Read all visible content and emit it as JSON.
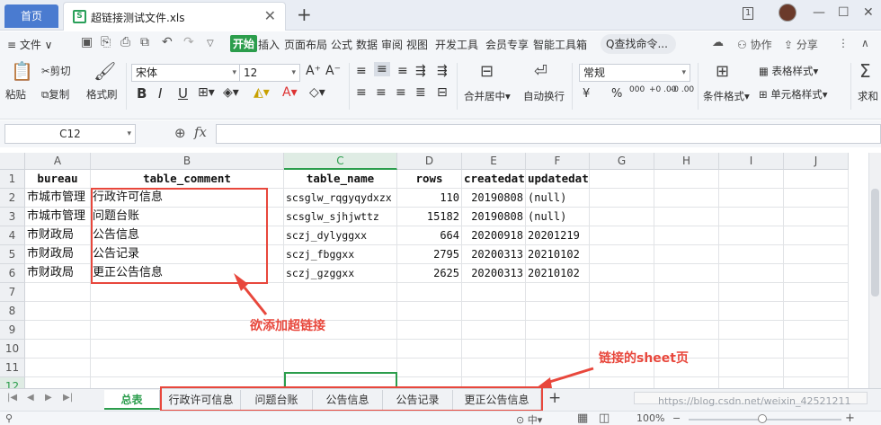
{
  "titlebar": {
    "home_tab": "首页",
    "file_name": "超链接测试文件.xls",
    "file_icon": "S",
    "close_glyph": "✕",
    "newtab_glyph": "+",
    "page_indicator": "1",
    "minimize_glyph": "—",
    "maximize_glyph": "☐",
    "close_window_glyph": "✕"
  },
  "menubar": {
    "hamburger": "≡ 文件 ∨",
    "items": [
      "开始",
      "插入",
      "页面布局",
      "公式",
      "数据",
      "审阅",
      "视图",
      "开发工具",
      "会员专享",
      "智能工具箱"
    ],
    "active_item": "开始",
    "search": "Q查找命令...",
    "collab": "协作",
    "share": "分享"
  },
  "ribbon": {
    "paste": "粘贴",
    "cut": "剪切",
    "copy": "复制",
    "format_painter": "格式刷",
    "font_name": "宋体",
    "font_size": "12",
    "bold": "B",
    "italic": "I",
    "underline": "U",
    "merge_center": "合并居中",
    "wrap_text": "自动换行",
    "number_format": "常规",
    "currency": "¥",
    "percent": "%",
    "thousands": "000",
    "inc_decimal": "+0 .00",
    "dec_decimal": "-0 .00",
    "conditional_format": "条件格式",
    "table_style": "表格样式",
    "cell_style": "单元格样式",
    "sum": "求和"
  },
  "formulabar": {
    "name_box": "C12",
    "fx": "fx",
    "formula": ""
  },
  "grid": {
    "columns": [
      "A",
      "B",
      "C",
      "D",
      "E",
      "F",
      "G",
      "H",
      "I",
      "J"
    ],
    "selected_column": "C",
    "row_numbers": [
      "1",
      "2",
      "3",
      "4",
      "5",
      "6",
      "7",
      "8",
      "9",
      "10",
      "11",
      "12"
    ],
    "selected_row": "12",
    "header_row": [
      "bureau",
      "table_comment",
      "table_name",
      "rows",
      "createdate",
      "updatedate"
    ],
    "rows": [
      [
        "市城市管理",
        "行政许可信息",
        "scsglw_rqgyqydxzx",
        "110",
        "20190808",
        "(null)"
      ],
      [
        "市城市管理",
        "问题台账",
        "scsglw_sjhjwttz",
        "15182",
        "20190808",
        "(null)"
      ],
      [
        "市财政局",
        "公告信息",
        "sczj_dylyggxx",
        "664",
        "20200918",
        "20201219"
      ],
      [
        "市财政局",
        "公告记录",
        "sczj_fbggxx",
        "2795",
        "20200313",
        "20210102"
      ],
      [
        "市财政局",
        "更正公告信息",
        "sczj_gzggxx",
        "2625",
        "20200313",
        "20210102"
      ]
    ]
  },
  "annotations": {
    "add_hyperlink": "欲添加超链接",
    "linked_sheets": "链接的sheet页"
  },
  "sheets": {
    "tabs": [
      "总表",
      "行政许可信息",
      "问题台账",
      "公告信息",
      "公告记录",
      "更正公告信息"
    ],
    "active": "总表",
    "add": "+"
  },
  "watermark": "https://blog.csdn.net/weixin_42521211",
  "statusbar": {
    "zoom": "100%",
    "zoom_minus": "−",
    "zoom_plus": "+"
  },
  "colors": {
    "accent_green": "#2b9d4c",
    "annotation_red": "#e8473c",
    "home_blue": "#4a7bd0"
  }
}
